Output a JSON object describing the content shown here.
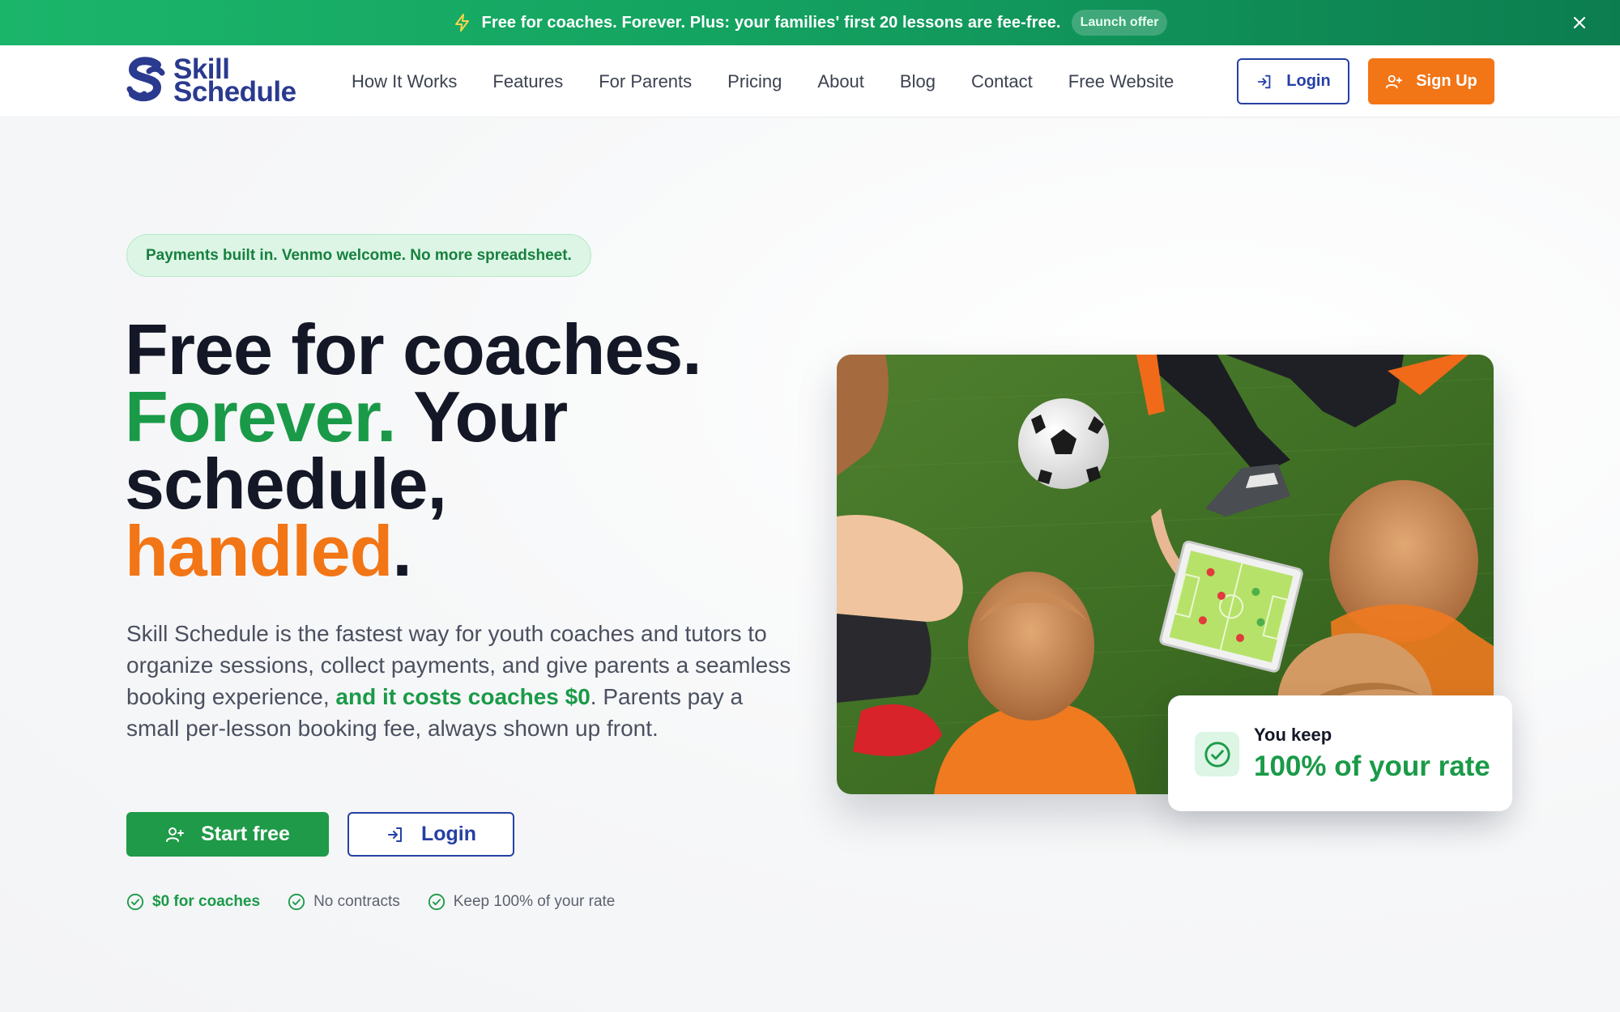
{
  "announcement": {
    "icon": "lightning-bolt-icon",
    "message": "Free for coaches. Forever. Plus: your families' first 20 lessons are fee-free.",
    "pill": "Launch offer",
    "close_icon": "close-icon"
  },
  "brand": {
    "line1": "Skill",
    "line2": "Schedule",
    "color": "#2a3a8f"
  },
  "nav": {
    "items": [
      "How It Works",
      "Features",
      "For Parents",
      "Pricing",
      "About",
      "Blog",
      "Contact",
      "Free Website"
    ],
    "login_label": "Login",
    "signup_label": "Sign Up"
  },
  "hero": {
    "badge": "Payments built in. Venmo welcome. No more spreadsheet.",
    "headline": {
      "line1": "Free for coaches.",
      "forever": "Forever.",
      "your": " Your",
      "line3": "schedule,",
      "handled": "handled",
      "period": "."
    },
    "lede": {
      "part1": "Skill Schedule is the fastest way for youth coaches and tutors to organize sessions, collect payments, and give parents a seamless booking experience, ",
      "highlight": "and it costs coaches $0",
      "part2": ". Parents pay a small per-lesson booking fee, always shown up front."
    },
    "start_label": "Start free",
    "login_label": "Login",
    "perks": [
      "$0 for coaches",
      "No contracts",
      "Keep 100% of your rate"
    ]
  },
  "keep_card": {
    "small": "You keep",
    "big": "100% of your rate"
  },
  "colors": {
    "green": "#1a9a48",
    "orange": "#f27516",
    "navy": "#2540a4",
    "dark": "#141726"
  }
}
